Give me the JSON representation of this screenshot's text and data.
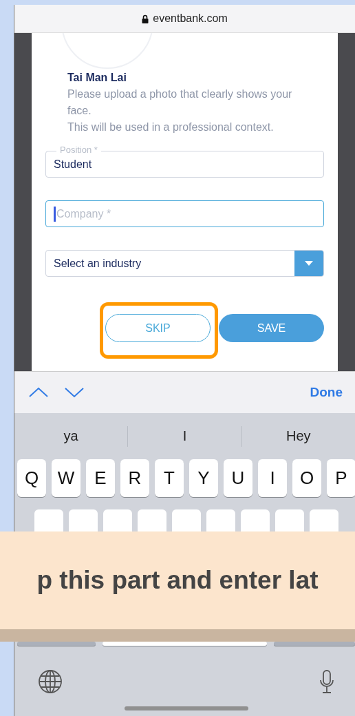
{
  "address_bar": {
    "url": "eventbank.com"
  },
  "profile": {
    "name": "Tai Man Lai",
    "hint_lines": [
      "Please upload a photo that clearly shows your face.",
      "This will be used in a professional context."
    ]
  },
  "fields": [
    {
      "kind": "outlined",
      "label": "Position *",
      "value": "Student",
      "focused": false
    },
    {
      "kind": "text",
      "placeholder": "Company *",
      "focused": true
    },
    {
      "kind": "select",
      "value": "Select an industry"
    }
  ],
  "buttons": [
    {
      "label": "SKIP",
      "kind": "outline",
      "highlighted": true
    },
    {
      "label": "SAVE",
      "kind": "filled"
    }
  ],
  "keyboard": {
    "done": "Done",
    "suggestions": [
      "ya",
      "I",
      "Hey"
    ],
    "rows": [
      [
        "Q",
        "W",
        "E",
        "R",
        "T",
        "Y",
        "U",
        "I",
        "O",
        "P"
      ]
    ]
  },
  "caption": "p this part and enter lat"
}
